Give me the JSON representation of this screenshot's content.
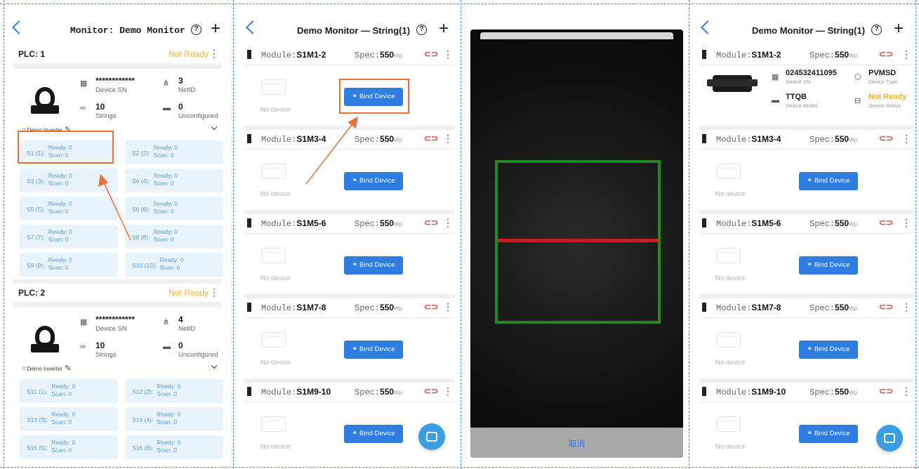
{
  "colors": {
    "accent": "#2f7de1",
    "warning": "#f5b41a",
    "highlight": "#ea7136",
    "scan_frame": "#1f8a22",
    "scan_line": "#c42020",
    "link_red": "#e0403a"
  },
  "panel1": {
    "title": "Monitor: Demo Monitor",
    "help_icon": "?",
    "plus_icon": "+",
    "plcs": [
      {
        "name": "PLC: 1",
        "status": "Not Ready",
        "sn": "************",
        "sn_label": "Device SN",
        "netid": "3",
        "netid_label": "NetID",
        "strings": "10",
        "strings_label": "Strings",
        "unconfigured": "0",
        "unconfigured_label": "Unconfigured",
        "inverter": "Demo Inverter",
        "string_items": [
          {
            "name": "S1 (1):",
            "ready": "Ready: 0",
            "scan": "Scan: 0"
          },
          {
            "name": "S2 (2):",
            "ready": "Ready: 0",
            "scan": "Scan: 0"
          },
          {
            "name": "S3 (3):",
            "ready": "Ready: 0",
            "scan": "Scan: 0"
          },
          {
            "name": "S4 (4):",
            "ready": "Ready: 0",
            "scan": "Scan: 0"
          },
          {
            "name": "S5 (5):",
            "ready": "Ready: 0",
            "scan": "Scan: 0"
          },
          {
            "name": "S6 (6):",
            "ready": "Ready: 0",
            "scan": "Scan: 0"
          },
          {
            "name": "S7 (7):",
            "ready": "Ready: 0",
            "scan": "Scan: 0"
          },
          {
            "name": "S8 (8):",
            "ready": "Ready: 0",
            "scan": "Scan: 0"
          },
          {
            "name": "S9 (9):",
            "ready": "Ready: 0",
            "scan": "Scan: 0"
          },
          {
            "name": "S10 (10):",
            "ready": "Ready: 0",
            "scan": "Scan: 0"
          }
        ]
      },
      {
        "name": "PLC: 2",
        "status": "Not Ready",
        "sn": "************",
        "sn_label": "Device SN",
        "netid": "4",
        "netid_label": "NetID",
        "strings": "10",
        "strings_label": "Strings",
        "unconfigured": "0",
        "unconfigured_label": "Unconfigured",
        "inverter": "Demo Inverter",
        "string_items": [
          {
            "name": "S11 (1):",
            "ready": "Ready: 0",
            "scan": "Scan: 0"
          },
          {
            "name": "S12 (2):",
            "ready": "Ready: 0",
            "scan": "Scan: 0"
          },
          {
            "name": "S13 (3):",
            "ready": "Ready: 0",
            "scan": "Scan: 0"
          },
          {
            "name": "S14 (4):",
            "ready": "Ready: 0",
            "scan": "Scan: 0"
          },
          {
            "name": "S15 (5):",
            "ready": "Ready: 0",
            "scan": "Scan: 0"
          },
          {
            "name": "S16 (6):",
            "ready": "Ready: 0",
            "scan": "Scan: 0"
          }
        ]
      }
    ]
  },
  "panel2": {
    "title": "Demo Monitor — String(1)",
    "module_prefix": "Module:",
    "spec_prefix": "Spec:",
    "spec_value": "550",
    "spec_unit": "Wp",
    "no_device": "No device",
    "bind_label": "Bind Device",
    "modules": [
      "S1M1-2",
      "S1M3-4",
      "S1M5-6",
      "S1M7-8",
      "S1M9-10"
    ]
  },
  "panel3": {
    "cancel_label": "取消"
  },
  "panel4": {
    "title": "Demo Monitor — String(1)",
    "first": {
      "sn": "024532411095",
      "sn_label": "Device SN",
      "type": "PVMSD",
      "type_label": "Device Type",
      "model": "TTQB",
      "model_label": "Device Model",
      "status": "Not Ready",
      "status_label": "Device Status"
    }
  }
}
